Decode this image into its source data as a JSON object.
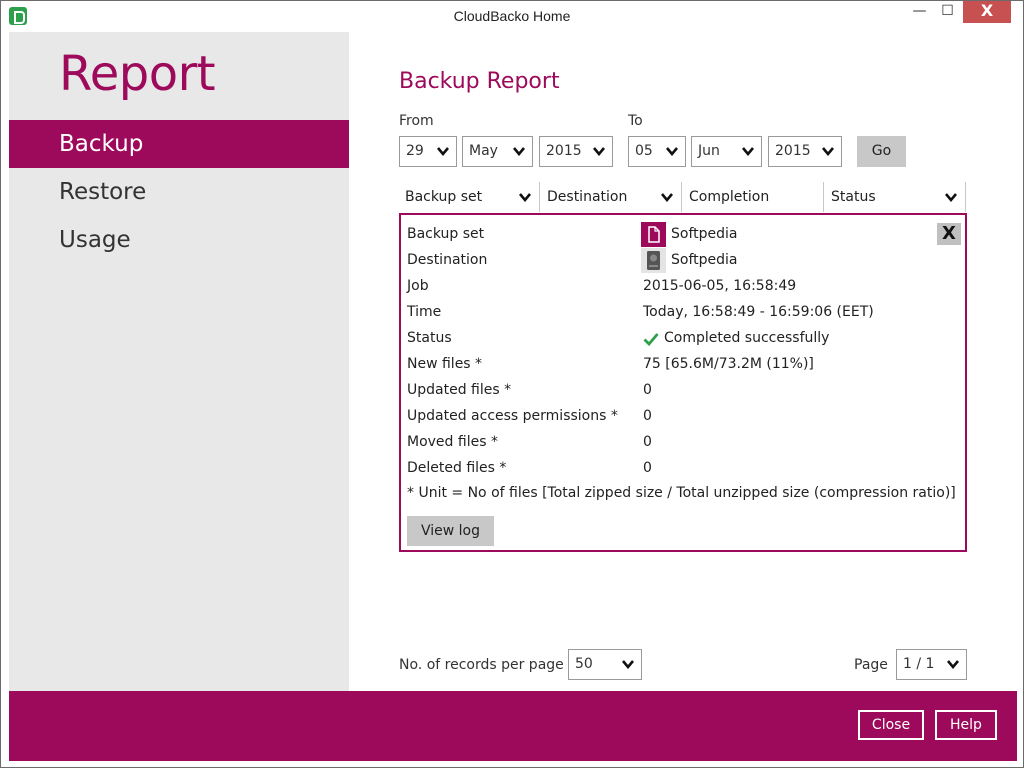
{
  "window": {
    "title": "CloudBacko Home",
    "minimize_glyph": "—",
    "maximize_glyph": "☐",
    "close_glyph": "X"
  },
  "sidebar": {
    "title": "Report",
    "items": [
      {
        "label": "Backup",
        "active": true
      },
      {
        "label": "Restore",
        "active": false
      },
      {
        "label": "Usage",
        "active": false
      }
    ]
  },
  "main": {
    "title": "Backup Report",
    "from_label": "From",
    "to_label": "To",
    "from": {
      "day": "29",
      "month": "May",
      "year": "2015"
    },
    "to": {
      "day": "05",
      "month": "Jun",
      "year": "2015"
    },
    "go_label": "Go",
    "columns": [
      "Backup set",
      "Destination",
      "Completion",
      "Status"
    ]
  },
  "detail": {
    "close_label": "X",
    "rows": [
      {
        "label": "Backup set",
        "value": "Softpedia",
        "icon": "document-icon"
      },
      {
        "label": "Destination",
        "value": "Softpedia",
        "icon": "hard-drive-icon"
      },
      {
        "label": "Job",
        "value": "2015-06-05, 16:58:49"
      },
      {
        "label": "Time",
        "value": "Today, 16:58:49 - 16:59:06 (EET)"
      },
      {
        "label": "Status",
        "value": "Completed successfully",
        "icon": "check-icon"
      },
      {
        "label": "New files *",
        "value": "75 [65.6M/73.2M (11%)]"
      },
      {
        "label": "Updated files *",
        "value": "0"
      },
      {
        "label": "Updated access permissions *",
        "value": "0"
      },
      {
        "label": "Moved files *",
        "value": "0"
      },
      {
        "label": "Deleted files *",
        "value": "0"
      }
    ],
    "note": "* Unit = No of files [Total zipped size / Total unzipped size (compression ratio)]",
    "view_log_label": "View log"
  },
  "pagination": {
    "records_label": "No. of records per page",
    "records_value": "50",
    "page_label": "Page",
    "page_value": "1 / 1"
  },
  "footer": {
    "close_label": "Close",
    "help_label": "Help"
  },
  "colors": {
    "accent": "#9d0a5b",
    "success": "#2e9f4a"
  }
}
